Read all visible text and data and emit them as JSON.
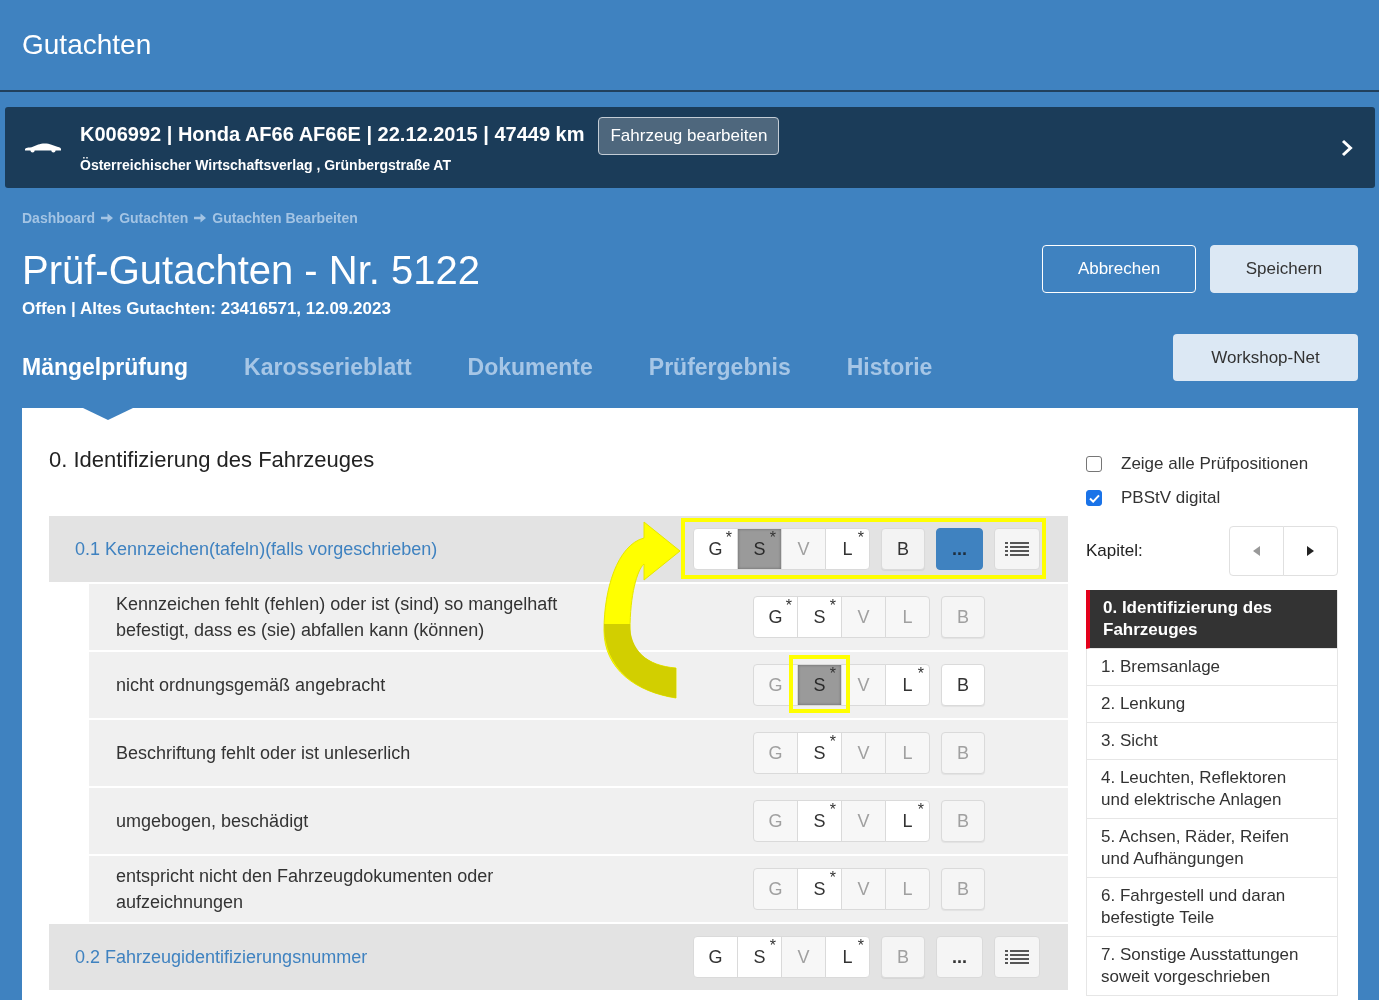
{
  "header": {
    "title": "Gutachten"
  },
  "vehicle": {
    "summary": "K006992 | Honda AF66 AF66E | 22.12.2015 | 47449 km",
    "owner": "Österreichischer Wirtschaftsverlag , Grünbergstraße AT",
    "edit_button": "Fahrzeug bearbeiten"
  },
  "breadcrumb": [
    "Dashboard",
    "Gutachten",
    "Gutachten Bearbeiten"
  ],
  "title": "Prüf-Gutachten - Nr. 5122",
  "subtitle": "Offen | Altes Gutachten: 23416571, 12.09.2023",
  "actions": [
    {
      "label": "Abbrechen",
      "kind": "outline"
    },
    {
      "label": "Speichern",
      "kind": "filled"
    }
  ],
  "tabs": [
    {
      "label": "Mängelprüfung",
      "selected": true
    },
    {
      "label": "Karosserieblatt",
      "selected": false
    },
    {
      "label": "Dokumente",
      "selected": false
    },
    {
      "label": "Prüfergebnis",
      "selected": false
    },
    {
      "label": "Historie",
      "selected": false
    }
  ],
  "workshop_button": "Workshop-Net",
  "section_title": "0. Identifizierung des Fahrzeuges",
  "sections": [
    {
      "title": "0.1 Kennzeichen(tafeln)(falls vorgeschrieben)",
      "highlighted": true,
      "ratings": [
        {
          "label": "G",
          "mark": "*",
          "available": true,
          "selected": false
        },
        {
          "label": "S",
          "mark": "*",
          "available": true,
          "selected": true
        },
        {
          "label": "V",
          "available": false,
          "selected": false
        },
        {
          "label": "L",
          "mark": "*",
          "available": true,
          "selected": false
        }
      ],
      "b_button": {
        "label": "B",
        "available": true
      },
      "more_button": {
        "label": "...",
        "selected": true
      },
      "items": [
        {
          "text": "Kennzeichen fehlt (fehlen) oder ist (sind) so mangelhaft befestigt, dass es (sie) abfallen kann (können)",
          "highlighted": false,
          "ratings": [
            {
              "label": "G",
              "mark": "*",
              "available": true,
              "selected": false
            },
            {
              "label": "S",
              "mark": "*",
              "available": true,
              "selected": false
            },
            {
              "label": "V",
              "available": false,
              "selected": false
            },
            {
              "label": "L",
              "available": false,
              "selected": false
            }
          ],
          "b_button": {
            "label": "B",
            "available": false
          }
        },
        {
          "text": "nicht ordnungsgemäß angebracht",
          "highlighted": true,
          "ratings": [
            {
              "label": "G",
              "available": false,
              "selected": false
            },
            {
              "label": "S",
              "mark": "*",
              "available": true,
              "selected": true
            },
            {
              "label": "V",
              "available": false,
              "selected": false
            },
            {
              "label": "L",
              "mark": "*",
              "available": true,
              "selected": false
            }
          ],
          "b_button": {
            "label": "B",
            "available": true
          }
        },
        {
          "text": "Beschriftung fehlt oder ist unleserlich",
          "highlighted": false,
          "ratings": [
            {
              "label": "G",
              "available": false,
              "selected": false
            },
            {
              "label": "S",
              "mark": "*",
              "available": true,
              "selected": false
            },
            {
              "label": "V",
              "available": false,
              "selected": false
            },
            {
              "label": "L",
              "available": false,
              "selected": false
            }
          ],
          "b_button": {
            "label": "B",
            "available": false
          }
        },
        {
          "text": "umgebogen, beschädigt",
          "highlighted": false,
          "ratings": [
            {
              "label": "G",
              "available": false,
              "selected": false
            },
            {
              "label": "S",
              "mark": "*",
              "available": true,
              "selected": false
            },
            {
              "label": "V",
              "available": false,
              "selected": false
            },
            {
              "label": "L",
              "mark": "*",
              "available": true,
              "selected": false
            }
          ],
          "b_button": {
            "label": "B",
            "available": false
          }
        },
        {
          "text": "entspricht nicht den Fahrzeugdokumenten oder aufzeichnungen",
          "highlighted": false,
          "ratings": [
            {
              "label": "G",
              "available": false,
              "selected": false
            },
            {
              "label": "S",
              "mark": "*",
              "available": true,
              "selected": false
            },
            {
              "label": "V",
              "available": false,
              "selected": false
            },
            {
              "label": "L",
              "available": false,
              "selected": false
            }
          ],
          "b_button": {
            "label": "B",
            "available": false
          }
        }
      ]
    },
    {
      "title": "0.2 Fahrzeugidentifizierungsnummer",
      "highlighted": false,
      "ratings": [
        {
          "label": "G",
          "available": true,
          "selected": false
        },
        {
          "label": "S",
          "mark": "*",
          "available": true,
          "selected": false
        },
        {
          "label": "V",
          "available": false,
          "selected": false
        },
        {
          "label": "L",
          "mark": "*",
          "available": true,
          "selected": false
        }
      ],
      "b_button": {
        "label": "B",
        "available": false
      },
      "more_button": {
        "label": "...",
        "selected": false
      }
    }
  ],
  "filters": [
    {
      "label": "Zeige alle Prüfpositionen",
      "checked": false
    },
    {
      "label": "PBStV digital",
      "checked": true
    }
  ],
  "chapter_nav": {
    "label": "Kapitel:",
    "prev_disabled": true,
    "next_disabled": false
  },
  "chapters": [
    {
      "label": "0. Identifizierung des Fahrzeuges",
      "selected": true
    },
    {
      "label": "1. Bremsanlage",
      "selected": false
    },
    {
      "label": "2. Lenkung",
      "selected": false
    },
    {
      "label": "3. Sicht",
      "selected": false
    },
    {
      "label": "4. Leuchten, Reflektoren und elektrische Anlagen",
      "selected": false
    },
    {
      "label": "5. Achsen, Räder, Reifen und Aufhängungen",
      "selected": false
    },
    {
      "label": "6. Fahrgestell und daran befestigte Teile",
      "selected": false
    },
    {
      "label": "7. Sonstige Ausstattungen soweit vorgeschrieben",
      "selected": false
    }
  ],
  "annotation_arrow": true
}
